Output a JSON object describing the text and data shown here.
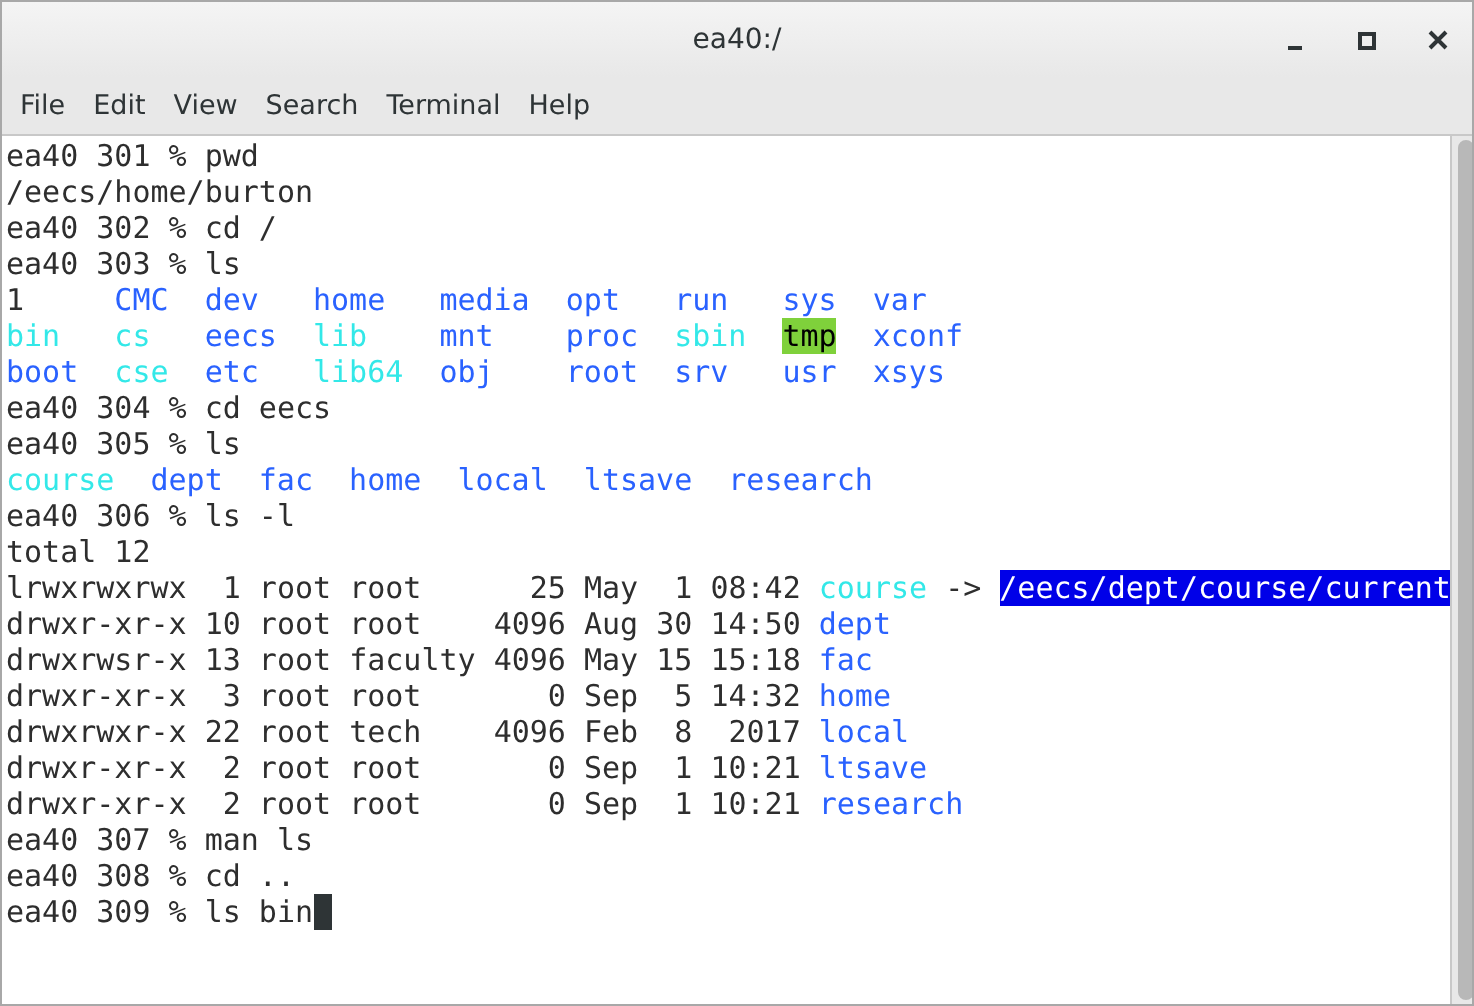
{
  "window": {
    "title": "ea40:/"
  },
  "menu": [
    "File",
    "Edit",
    "View",
    "Search",
    "Terminal",
    "Help"
  ],
  "terminal": {
    "lines": [
      {
        "kind": "text",
        "segments": [
          {
            "kind": "plain",
            "text": "ea40 301 % pwd"
          }
        ]
      },
      {
        "kind": "text",
        "segments": [
          {
            "kind": "plain",
            "text": "/eecs/home/burton"
          }
        ]
      },
      {
        "kind": "text",
        "segments": [
          {
            "kind": "plain",
            "text": "ea40 302 % cd /"
          }
        ]
      },
      {
        "kind": "text",
        "segments": [
          {
            "kind": "plain",
            "text": "ea40 303 % ls"
          }
        ]
      },
      {
        "kind": "grid",
        "rows": [
          [
            {
              "kind": "plain",
              "text": "1"
            },
            {
              "kind": "dir",
              "text": "CMC"
            },
            {
              "kind": "dir",
              "text": "dev"
            },
            {
              "kind": "dir",
              "text": "home"
            },
            {
              "kind": "dir",
              "text": "media"
            },
            {
              "kind": "dir",
              "text": "opt"
            },
            {
              "kind": "dir",
              "text": "run"
            },
            {
              "kind": "dir",
              "text": "sys"
            },
            {
              "kind": "dir",
              "text": "var"
            }
          ],
          [
            {
              "kind": "link",
              "text": "bin"
            },
            {
              "kind": "link",
              "text": "cs"
            },
            {
              "kind": "dir",
              "text": "eecs"
            },
            {
              "kind": "link",
              "text": "lib"
            },
            {
              "kind": "dir",
              "text": "mnt"
            },
            {
              "kind": "dir",
              "text": "proc"
            },
            {
              "kind": "link",
              "text": "sbin"
            },
            {
              "kind": "sticky",
              "text": "tmp"
            },
            {
              "kind": "dir",
              "text": "xconf"
            }
          ],
          [
            {
              "kind": "dir",
              "text": "boot"
            },
            {
              "kind": "link",
              "text": "cse"
            },
            {
              "kind": "dir",
              "text": "etc"
            },
            {
              "kind": "link",
              "text": "lib64"
            },
            {
              "kind": "dir",
              "text": "obj"
            },
            {
              "kind": "dir",
              "text": "root"
            },
            {
              "kind": "dir",
              "text": "srv"
            },
            {
              "kind": "dir",
              "text": "usr"
            },
            {
              "kind": "dir",
              "text": "xsys"
            }
          ]
        ]
      },
      {
        "kind": "text",
        "segments": [
          {
            "kind": "plain",
            "text": "ea40 304 % cd eecs"
          }
        ]
      },
      {
        "kind": "text",
        "segments": [
          {
            "kind": "plain",
            "text": "ea40 305 % ls"
          }
        ]
      },
      {
        "kind": "grid",
        "rows": [
          [
            {
              "kind": "link",
              "text": "course"
            },
            {
              "kind": "dir",
              "text": "dept"
            },
            {
              "kind": "dir",
              "text": "fac"
            },
            {
              "kind": "dir",
              "text": "home"
            },
            {
              "kind": "dir",
              "text": "local"
            },
            {
              "kind": "dir",
              "text": "ltsave"
            },
            {
              "kind": "dir",
              "text": "research"
            }
          ]
        ]
      },
      {
        "kind": "text",
        "segments": [
          {
            "kind": "plain",
            "text": "ea40 306 % ls -l"
          }
        ]
      },
      {
        "kind": "text",
        "segments": [
          {
            "kind": "plain",
            "text": "total 12"
          }
        ]
      },
      {
        "kind": "text",
        "segments": [
          {
            "kind": "plain",
            "text": "lrwxrwxrwx  1 root root      25 May  1 08:42"
          },
          {
            "kind": "link",
            "text": "course"
          },
          {
            "kind": "plain",
            "text": "->"
          },
          {
            "kind": "selection",
            "text": "/eecs/dept/course/current"
          }
        ]
      },
      {
        "kind": "text",
        "segments": [
          {
            "kind": "plain",
            "text": "drwxr-xr-x 10 root root    4096 Aug 30 14:50"
          },
          {
            "kind": "dir",
            "text": "dept"
          }
        ]
      },
      {
        "kind": "text",
        "segments": [
          {
            "kind": "plain",
            "text": "drwxrwsr-x 13 root faculty 4096 May 15 15:18"
          },
          {
            "kind": "dir",
            "text": "fac"
          }
        ]
      },
      {
        "kind": "text",
        "segments": [
          {
            "kind": "plain",
            "text": "drwxr-xr-x  3 root root       0 Sep  5 14:32"
          },
          {
            "kind": "dir",
            "text": "home"
          }
        ]
      },
      {
        "kind": "text",
        "segments": [
          {
            "kind": "plain",
            "text": "drwxrwxr-x 22 root tech    4096 Feb  8  2017"
          },
          {
            "kind": "dir",
            "text": "local"
          }
        ]
      },
      {
        "kind": "text",
        "segments": [
          {
            "kind": "plain",
            "text": "drwxr-xr-x  2 root root       0 Sep  1 10:21"
          },
          {
            "kind": "dir",
            "text": "ltsave"
          }
        ]
      },
      {
        "kind": "text",
        "segments": [
          {
            "kind": "plain",
            "text": "drwxr-xr-x  2 root root       0 Sep  1 10:21"
          },
          {
            "kind": "dir",
            "text": "research"
          }
        ]
      },
      {
        "kind": "text",
        "segments": [
          {
            "kind": "plain",
            "text": "ea40 307 % man ls"
          }
        ]
      },
      {
        "kind": "text",
        "segments": [
          {
            "kind": "plain",
            "text": "ea40 308 % cd .."
          }
        ]
      },
      {
        "kind": "text",
        "segments": [
          {
            "kind": "plain",
            "text": "ea40 309 % ls bin"
          }
        ],
        "cursor": true
      }
    ]
  }
}
